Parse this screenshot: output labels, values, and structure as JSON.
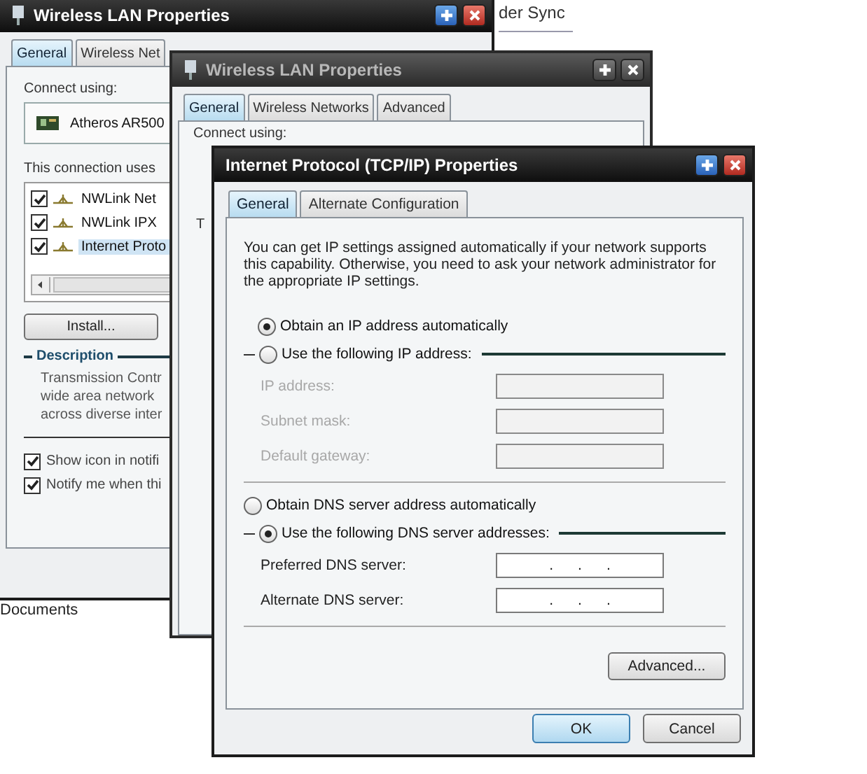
{
  "background": {
    "top_text": "der Sync",
    "bottom_text": "Documents"
  },
  "back_window": {
    "title": "Wireless LAN Properties",
    "active": true,
    "tabs": [
      {
        "label": "General",
        "selected": true
      },
      {
        "label": "Wireless Net",
        "selected": false
      }
    ],
    "connect_label": "Connect using:",
    "adapter": "Atheros AR500",
    "components_label": "This connection uses",
    "components": [
      {
        "label": "NWLink Net",
        "checked": true,
        "selected": false
      },
      {
        "label": "NWLink IPX",
        "checked": true,
        "selected": false
      },
      {
        "label": "Internet Proto",
        "checked": true,
        "selected": true
      }
    ],
    "install_button": "Install...",
    "description_title": "Description",
    "description_lines": [
      "Transmission Contr",
      "wide area network",
      "across diverse inter"
    ],
    "options": [
      {
        "label": "Show icon in notifi",
        "checked": true
      },
      {
        "label": "Notify me when thi",
        "checked": true
      }
    ]
  },
  "middle_window": {
    "title": "Wireless LAN Properties",
    "active": false,
    "tabs": [
      {
        "label": "General",
        "selected": true
      },
      {
        "label": "Wireless Networks",
        "selected": false
      },
      {
        "label": "Advanced",
        "selected": false
      }
    ],
    "connect_label": "Connect using:",
    "fragment": "T"
  },
  "dialog": {
    "title": "Internet Protocol (TCP/IP) Properties",
    "active": true,
    "tabs": [
      {
        "label": "General",
        "selected": true
      },
      {
        "label": "Alternate Configuration",
        "selected": false
      }
    ],
    "intro": "You can get IP settings assigned automatically if your network supports this capability. Otherwise, you need to ask your network administrator for the appropriate IP settings.",
    "ip_options": [
      {
        "label": "Obtain an IP address automatically",
        "selected": true
      },
      {
        "label": "Use the following IP address:",
        "selected": false
      }
    ],
    "ip_fields": [
      {
        "label": "IP address:",
        "disabled": true
      },
      {
        "label": "Subnet mask:",
        "disabled": true
      },
      {
        "label": "Default gateway:",
        "disabled": true
      }
    ],
    "dns_options": [
      {
        "label": "Obtain DNS server address automatically",
        "selected": false
      },
      {
        "label": "Use the following DNS server addresses:",
        "selected": true
      }
    ],
    "dns_fields": [
      {
        "label": "Preferred DNS server:",
        "disabled": false,
        "value": ".      .      ."
      },
      {
        "label": "Alternate DNS server:",
        "disabled": false,
        "value": ".      .      ."
      }
    ],
    "advanced_button": "Advanced...",
    "ok_button": "OK",
    "cancel_button": "Cancel"
  }
}
